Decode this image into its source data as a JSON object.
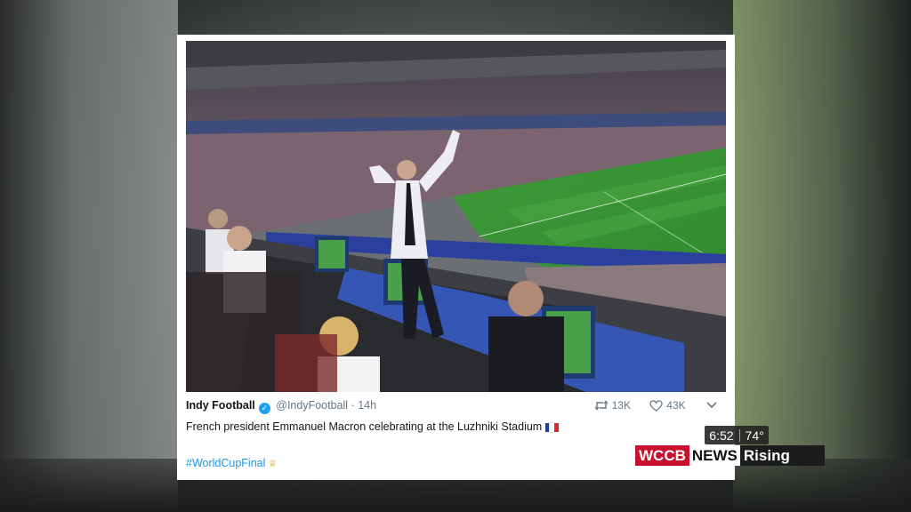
{
  "tweet": {
    "author_name": "Indy Football",
    "handle": "@IndyFootball",
    "separator": "·",
    "time": "14h",
    "text": "French president Emmanuel Macron celebrating at the Luzhniki Stadium",
    "hashtag": "#WorldCupFinal",
    "retweets": "13K",
    "likes": "43K"
  },
  "overlay": {
    "time": "6:52",
    "temperature": "74°",
    "logo_wccb": "WCCB",
    "logo_news": "NEWS",
    "logo_rising": "Rising"
  },
  "colors": {
    "link": "#1b95e0",
    "verified": "#1da1f2",
    "brand_red": "#c8102e",
    "pitch_green": "#3f9a3a"
  },
  "icons": {
    "verified": "verified-badge-icon",
    "retweet": "retweet-icon",
    "like": "heart-icon",
    "menu": "chevron-down-icon",
    "flag": "france-flag-icon",
    "hashtag_emoji": "trophy-icon"
  }
}
